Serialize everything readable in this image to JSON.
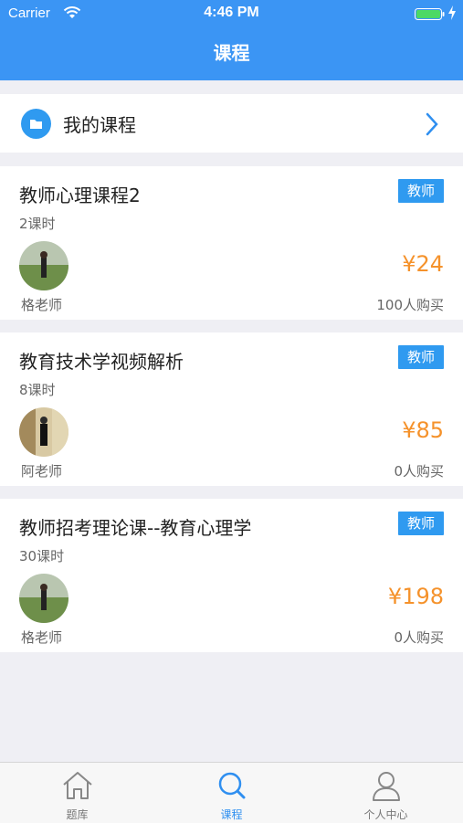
{
  "status_bar": {
    "carrier": "Carrier",
    "time": "4:46 PM"
  },
  "nav": {
    "title": "课程"
  },
  "my_courses": {
    "label": "我的课程"
  },
  "courses": [
    {
      "title": "教师心理课程2",
      "lessons": "2课时",
      "tag": "教师",
      "teacher": "格老师",
      "price": "¥24",
      "buyers": "100人购买"
    },
    {
      "title": "教育技术学视频解析",
      "lessons": "8课时",
      "tag": "教师",
      "teacher": "阿老师",
      "price": "¥85",
      "buyers": "0人购买"
    },
    {
      "title": "教师招考理论课--教育心理学",
      "lessons": "30课时",
      "tag": "教师",
      "teacher": "格老师",
      "price": "¥198",
      "buyers": "0人购买"
    }
  ],
  "tabs": [
    {
      "label": "题库",
      "icon": "home-icon"
    },
    {
      "label": "课程",
      "icon": "search-icon"
    },
    {
      "label": "个人中心",
      "icon": "person-icon"
    }
  ],
  "colors": {
    "accent": "#3b95f4",
    "price": "#f5922b",
    "tab_active": "#2f8ff0"
  }
}
